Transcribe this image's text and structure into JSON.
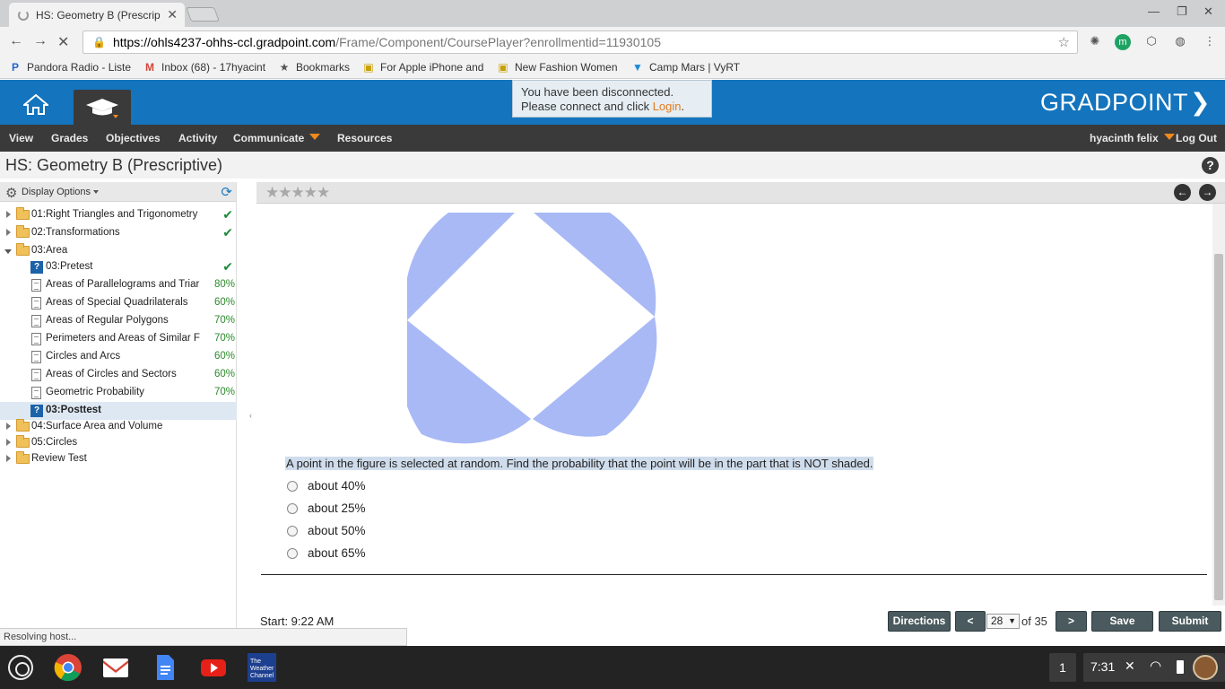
{
  "browser": {
    "tab_title": "HS: Geometry B (Prescrip",
    "url_host": "https://ohls4237-ohhs-ccl.gradpoint.com",
    "url_path": "/Frame/Component/CoursePlayer?enrollmentid=11930105",
    "bookmarks": [
      {
        "label": "Pandora Radio - Liste",
        "icon": "pandora-icon"
      },
      {
        "label": "Inbox (68) - 17hyacint",
        "icon": "gmail-icon"
      },
      {
        "label": "Bookmarks",
        "icon": "star-icon"
      },
      {
        "label": "For Apple iPhone and",
        "icon": "bag-icon"
      },
      {
        "label": "New Fashion Women",
        "icon": "bag-icon"
      },
      {
        "label": "Camp Mars | VyRT",
        "icon": "vyrt-icon"
      }
    ],
    "status_text": "Resolving host..."
  },
  "header": {
    "logo": "GRADPOINT",
    "disconnect_line1": "You have been disconnected.",
    "disconnect_line2": "Please connect and click ",
    "disconnect_link": "Login",
    "disconnect_end": "."
  },
  "menu": {
    "view": "View",
    "grades": "Grades",
    "objectives": "Objectives",
    "activity": "Activity",
    "communicate": "Communicate",
    "resources": "Resources",
    "user": "hyacinth felix",
    "logout": "Log Out"
  },
  "course_title": "HS: Geometry B (Prescriptive)",
  "sidebar": {
    "display_options": "Display Options",
    "items": [
      {
        "label": "01:Right Triangles and Trigonometry",
        "type": "folder",
        "level": 0,
        "status": "check"
      },
      {
        "label": "02:Transformations",
        "type": "folder",
        "level": 0,
        "status": "check"
      },
      {
        "label": "03:Area",
        "type": "folder-open",
        "level": 0,
        "status": ""
      },
      {
        "label": "03:Pretest",
        "type": "quiz",
        "level": 1,
        "status": "check"
      },
      {
        "label": "Areas of Parallelograms and Triar",
        "type": "page",
        "level": 1,
        "score": "80%"
      },
      {
        "label": "Areas of Special Quadrilaterals",
        "type": "page",
        "level": 1,
        "score": "60%"
      },
      {
        "label": "Areas of Regular Polygons",
        "type": "page",
        "level": 1,
        "score": "70%"
      },
      {
        "label": "Perimeters and Areas of Similar F",
        "type": "page",
        "level": 1,
        "score": "70%"
      },
      {
        "label": "Circles and Arcs",
        "type": "page",
        "level": 1,
        "score": "60%"
      },
      {
        "label": "Areas of Circles and Sectors",
        "type": "page",
        "level": 1,
        "score": "60%"
      },
      {
        "label": "Geometric Probability",
        "type": "page",
        "level": 1,
        "score": "70%"
      },
      {
        "label": "03:Posttest",
        "type": "quiz",
        "level": 1,
        "status": "",
        "selected": true
      },
      {
        "label": "04:Surface Area and Volume",
        "type": "folder",
        "level": 0,
        "status": ""
      },
      {
        "label": "05:Circles",
        "type": "folder",
        "level": 0,
        "status": ""
      },
      {
        "label": "Review Test",
        "type": "folder",
        "level": 0,
        "status": ""
      }
    ]
  },
  "question": {
    "text": "A point in the figure is selected at random. Find the probability that the point will be in the part that is NOT shaded.",
    "options": [
      "about 40%",
      "about 25%",
      "about 50%",
      "about 65%"
    ],
    "shaded_color": "#a9b9f5"
  },
  "footer": {
    "start": "Start: 9:22 AM",
    "directions": "Directions",
    "prev": "<",
    "page": "28",
    "of_total": "of 35",
    "next": ">",
    "save": "Save",
    "submit": "Submit"
  },
  "shelf": {
    "badge": "1",
    "time": "7:31"
  }
}
